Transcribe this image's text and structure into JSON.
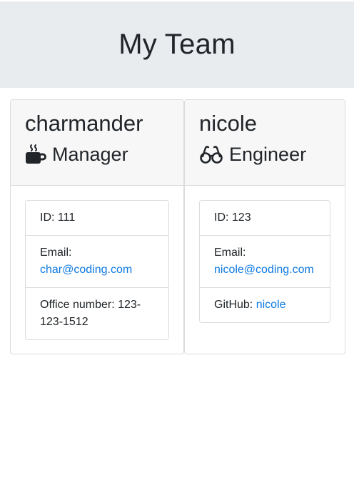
{
  "header": {
    "title": "My Team"
  },
  "members": [
    {
      "name": "charmander",
      "role": "Manager",
      "role_icon": "coffee-mug-icon",
      "id_text": "ID: 111",
      "email_label": "Email:",
      "email": "char@coding.com",
      "extra_text": "Office number: 123-123-1512"
    },
    {
      "name": "nicole",
      "role": "Engineer",
      "role_icon": "glasses-icon",
      "id_text": "ID: 123",
      "email_label": "Email:",
      "email": "nicole@coding.com",
      "extra_label": "GitHub: ",
      "extra_link": "nicole"
    }
  ],
  "colors": {
    "link": "#0d7ae0",
    "header_bg": "#e9ecef",
    "card_header_bg": "#f7f7f7"
  }
}
